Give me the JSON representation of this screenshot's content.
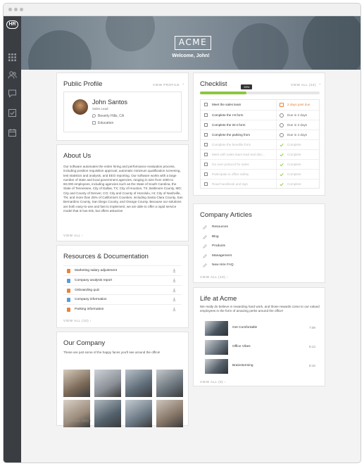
{
  "hero": {
    "brand": "ACME",
    "welcome": "Welcome, John!"
  },
  "public_profile": {
    "title": "Public Profile",
    "view_label": "VIEW PROFILE",
    "name": "John Santos",
    "role": "Sales Lead",
    "location": "Beverly Hills, CA",
    "department": "Education"
  },
  "about": {
    "title": "About Us",
    "text": "Our software automates the entire hiring and performance evaluation process, including position requisition approval, automatic minimum qualification screening, test statistics and analysis, and EEO reporting. Our software works with a large number of state and local government agencies, ranging in size from 1000 to 60,000 employees, including agencies such as the State of South Carolina, the State of Tennessee, City of Dallas, TX; City of Houston, TX; Baltimore County, MD; City and County of Denver, CO; City and County of Honolulu, HI; City of Nashville, TN; and more than 25% of California's Counties, including Santa Clara County, San Bernardino County, San Diego County, and Orange County. Because our solutions are both easy-to-use and fast to implement, we are able to offer a rapid service model that is low-risk, but offers attractive",
    "view_all": "VIEW ALL"
  },
  "resources": {
    "title": "Resources & Documentation",
    "items": [
      {
        "label": "Marketing salary adjustment",
        "color": "#e8833a"
      },
      {
        "label": "Company analysis report",
        "color": "#5b9bd5"
      },
      {
        "label": "Onboarding quiz",
        "color": "#e8833a"
      },
      {
        "label": "Company information",
        "color": "#5b9bd5"
      },
      {
        "label": "Parking information",
        "color": "#e8833a"
      }
    ],
    "view_all": "VIEW ALL (10)"
  },
  "our_company": {
    "title": "Our Company",
    "subtitle": "These are just some of the happy faces you'll see around the office!",
    "view_all": "VIEW ALL (24)"
  },
  "checklist": {
    "title": "Checklist",
    "view_all": "VIEW ALL (24)",
    "progress_percent": 39,
    "progress_label": "39%",
    "items": [
      {
        "task": "Meet the sales team",
        "status": "2 days past due",
        "state": "overdue"
      },
      {
        "task": "Complete the I-9 form",
        "status": "Due in 2 days",
        "state": "pending"
      },
      {
        "task": "Complete the W-4 form",
        "status": "Due in 3 days",
        "state": "pending"
      },
      {
        "task": "Complete the parking from",
        "status": "Due in 4 days",
        "state": "pending"
      },
      {
        "task": "Complete the benefits form",
        "status": "Complete",
        "state": "done"
      },
      {
        "task": "Meet with sales team lead and disc...",
        "status": "Complete",
        "state": "done"
      },
      {
        "task": "Go over protocol for sales",
        "status": "Complete",
        "state": "done"
      },
      {
        "task": "Participate in office safety",
        "status": "Complete",
        "state": "done"
      },
      {
        "task": "Read handbook and sign",
        "status": "Complete",
        "state": "done"
      }
    ]
  },
  "articles": {
    "title": "Company Articles",
    "items": [
      "Resources",
      "Blog",
      "Products",
      "Management",
      "New Hire FAQ"
    ],
    "view_all": "VIEW ALL (10)"
  },
  "life": {
    "title": "Life at Acme",
    "intro": "We really do believe in rewarding hard work, and those rewards come to our valued employees in the form of amazing perks around the office!",
    "videos": [
      {
        "title": "Get Comfortable",
        "duration": "7:09"
      },
      {
        "title": "Office Vibes",
        "duration": "6:14"
      },
      {
        "title": "Brainstorming",
        "duration": "8:10"
      }
    ],
    "view_all": "VIEW ALL (9)"
  },
  "colors": {
    "accent_green": "#8cc63f",
    "overdue": "#e8833a",
    "sidebar": "#3a3d42"
  },
  "icons": [
    "grid-icon",
    "people-icon",
    "chat-icon",
    "checkbox-icon",
    "calendar-icon"
  ]
}
